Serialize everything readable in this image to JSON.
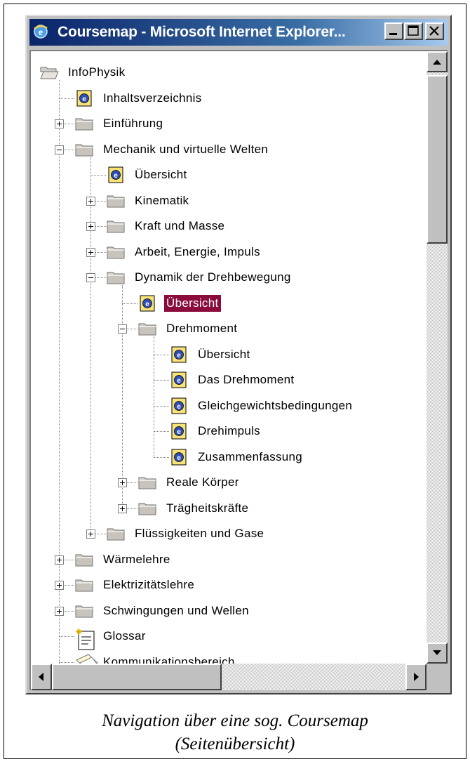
{
  "window": {
    "title": "Coursemap - Microsoft Internet Explorer...",
    "controls": [
      "minimize",
      "maximize",
      "close"
    ]
  },
  "tree": [
    {
      "label": "InfoPhysik",
      "level": 0,
      "icon": "folder-open-icon",
      "expander": "none"
    },
    {
      "label": "Inhaltsverzeichnis",
      "level": 1,
      "icon": "document-icon",
      "expander": "none"
    },
    {
      "label": "Einführung",
      "level": 1,
      "icon": "folder-icon",
      "expander": "plus"
    },
    {
      "label": "Mechanik und virtuelle Welten",
      "level": 1,
      "icon": "folder-icon",
      "expander": "minus"
    },
    {
      "label": "Übersicht",
      "level": 2,
      "icon": "document-icon",
      "expander": "none"
    },
    {
      "label": "Kinematik",
      "level": 2,
      "icon": "folder-icon",
      "expander": "plus"
    },
    {
      "label": "Kraft und Masse",
      "level": 2,
      "icon": "folder-icon",
      "expander": "plus"
    },
    {
      "label": "Arbeit, Energie, Impuls",
      "level": 2,
      "icon": "folder-icon",
      "expander": "plus"
    },
    {
      "label": "Dynamik der Drehbewegung",
      "level": 2,
      "icon": "folder-icon",
      "expander": "minus"
    },
    {
      "label": "Übersicht",
      "level": 3,
      "icon": "document-icon",
      "expander": "none",
      "selected": true
    },
    {
      "label": "Drehmoment",
      "level": 3,
      "icon": "folder-icon",
      "expander": "minus"
    },
    {
      "label": "Übersicht",
      "level": 4,
      "icon": "document-icon",
      "expander": "none"
    },
    {
      "label": "Das Drehmoment",
      "level": 4,
      "icon": "document-icon",
      "expander": "none"
    },
    {
      "label": "Gleichgewichtsbedingungen",
      "level": 4,
      "icon": "document-icon",
      "expander": "none"
    },
    {
      "label": "Drehimpuls",
      "level": 4,
      "icon": "document-icon",
      "expander": "none"
    },
    {
      "label": "Zusammenfassung",
      "level": 4,
      "icon": "document-icon",
      "expander": "none"
    },
    {
      "label": "Reale Körper",
      "level": 3,
      "icon": "folder-icon",
      "expander": "plus"
    },
    {
      "label": "Trägheitskräfte",
      "level": 3,
      "icon": "folder-icon",
      "expander": "plus"
    },
    {
      "label": "Flüssigkeiten und Gase",
      "level": 2,
      "icon": "folder-icon",
      "expander": "plus"
    },
    {
      "label": "Wärmelehre",
      "level": 1,
      "icon": "folder-icon",
      "expander": "plus"
    },
    {
      "label": "Elektrizitätslehre",
      "level": 1,
      "icon": "folder-icon",
      "expander": "plus"
    },
    {
      "label": "Schwingungen und Wellen",
      "level": 1,
      "icon": "folder-icon",
      "expander": "plus"
    },
    {
      "label": "Glossar",
      "level": 1,
      "icon": "glossary-icon",
      "expander": "none"
    },
    {
      "label": "Kommunikationsbereich",
      "level": 1,
      "icon": "communication-icon",
      "expander": "none"
    },
    {
      "label": "",
      "level": 1,
      "icon": "folder-icon",
      "expander": "plus"
    }
  ],
  "caption": {
    "line1": "Navigation über eine sog. Coursemap",
    "line2": "(Seitenübersicht)"
  },
  "colors": {
    "selection": "#8b0c3c",
    "titlebar": "#0a246a"
  }
}
